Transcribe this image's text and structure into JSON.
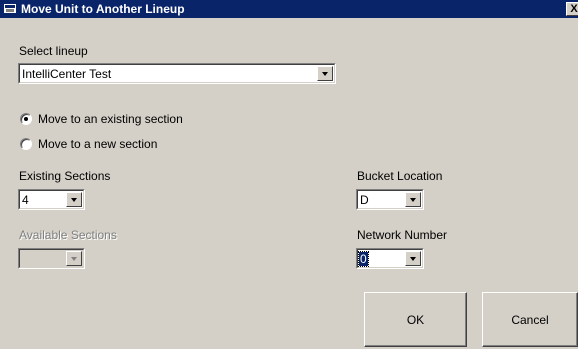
{
  "window": {
    "title": "Move Unit to Another Lineup",
    "close_label": "X"
  },
  "lineup": {
    "label": "Select lineup",
    "selected": "IntelliCenter Test"
  },
  "move_options": {
    "existing_label": "Move to an existing section",
    "new_label": "Move to a new section",
    "selected": "existing"
  },
  "existing_sections": {
    "label": "Existing Sections",
    "value": "4"
  },
  "available_sections": {
    "label": "Available Sections",
    "value": "",
    "enabled": false
  },
  "bucket_location": {
    "label": "Bucket Location",
    "value": "D"
  },
  "network_number": {
    "label": "Network Number",
    "value": "0"
  },
  "buttons": {
    "ok": "OK",
    "cancel": "Cancel"
  },
  "colors": {
    "titlebar": "#0a246a",
    "face": "#d4d0c8"
  }
}
